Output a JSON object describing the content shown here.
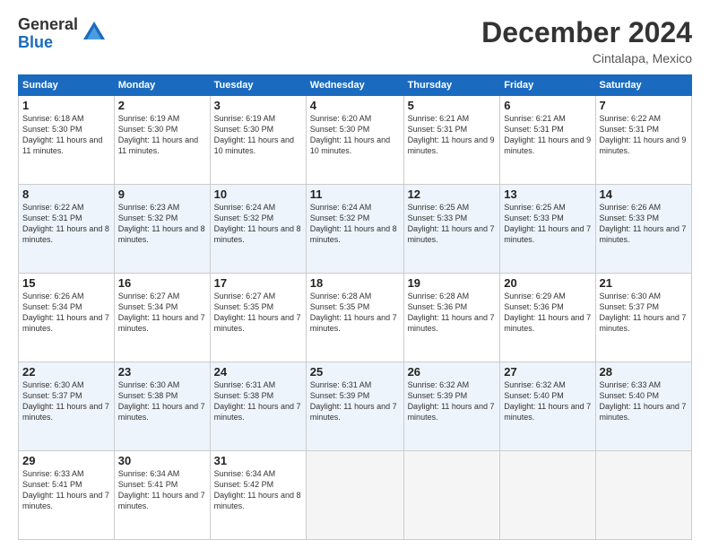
{
  "logo": {
    "general": "General",
    "blue": "Blue"
  },
  "title": "December 2024",
  "location": "Cintalapa, Mexico",
  "days_header": [
    "Sunday",
    "Monday",
    "Tuesday",
    "Wednesday",
    "Thursday",
    "Friday",
    "Saturday"
  ],
  "weeks": [
    [
      {
        "day": "1",
        "sunrise": "6:18 AM",
        "sunset": "5:30 PM",
        "daylight": "11 hours and 11 minutes."
      },
      {
        "day": "2",
        "sunrise": "6:19 AM",
        "sunset": "5:30 PM",
        "daylight": "11 hours and 11 minutes."
      },
      {
        "day": "3",
        "sunrise": "6:19 AM",
        "sunset": "5:30 PM",
        "daylight": "11 hours and 10 minutes."
      },
      {
        "day": "4",
        "sunrise": "6:20 AM",
        "sunset": "5:30 PM",
        "daylight": "11 hours and 10 minutes."
      },
      {
        "day": "5",
        "sunrise": "6:21 AM",
        "sunset": "5:31 PM",
        "daylight": "11 hours and 9 minutes."
      },
      {
        "day": "6",
        "sunrise": "6:21 AM",
        "sunset": "5:31 PM",
        "daylight": "11 hours and 9 minutes."
      },
      {
        "day": "7",
        "sunrise": "6:22 AM",
        "sunset": "5:31 PM",
        "daylight": "11 hours and 9 minutes."
      }
    ],
    [
      {
        "day": "8",
        "sunrise": "6:22 AM",
        "sunset": "5:31 PM",
        "daylight": "11 hours and 8 minutes."
      },
      {
        "day": "9",
        "sunrise": "6:23 AM",
        "sunset": "5:32 PM",
        "daylight": "11 hours and 8 minutes."
      },
      {
        "day": "10",
        "sunrise": "6:24 AM",
        "sunset": "5:32 PM",
        "daylight": "11 hours and 8 minutes."
      },
      {
        "day": "11",
        "sunrise": "6:24 AM",
        "sunset": "5:32 PM",
        "daylight": "11 hours and 8 minutes."
      },
      {
        "day": "12",
        "sunrise": "6:25 AM",
        "sunset": "5:33 PM",
        "daylight": "11 hours and 7 minutes."
      },
      {
        "day": "13",
        "sunrise": "6:25 AM",
        "sunset": "5:33 PM",
        "daylight": "11 hours and 7 minutes."
      },
      {
        "day": "14",
        "sunrise": "6:26 AM",
        "sunset": "5:33 PM",
        "daylight": "11 hours and 7 minutes."
      }
    ],
    [
      {
        "day": "15",
        "sunrise": "6:26 AM",
        "sunset": "5:34 PM",
        "daylight": "11 hours and 7 minutes."
      },
      {
        "day": "16",
        "sunrise": "6:27 AM",
        "sunset": "5:34 PM",
        "daylight": "11 hours and 7 minutes."
      },
      {
        "day": "17",
        "sunrise": "6:27 AM",
        "sunset": "5:35 PM",
        "daylight": "11 hours and 7 minutes."
      },
      {
        "day": "18",
        "sunrise": "6:28 AM",
        "sunset": "5:35 PM",
        "daylight": "11 hours and 7 minutes."
      },
      {
        "day": "19",
        "sunrise": "6:28 AM",
        "sunset": "5:36 PM",
        "daylight": "11 hours and 7 minutes."
      },
      {
        "day": "20",
        "sunrise": "6:29 AM",
        "sunset": "5:36 PM",
        "daylight": "11 hours and 7 minutes."
      },
      {
        "day": "21",
        "sunrise": "6:30 AM",
        "sunset": "5:37 PM",
        "daylight": "11 hours and 7 minutes."
      }
    ],
    [
      {
        "day": "22",
        "sunrise": "6:30 AM",
        "sunset": "5:37 PM",
        "daylight": "11 hours and 7 minutes."
      },
      {
        "day": "23",
        "sunrise": "6:30 AM",
        "sunset": "5:38 PM",
        "daylight": "11 hours and 7 minutes."
      },
      {
        "day": "24",
        "sunrise": "6:31 AM",
        "sunset": "5:38 PM",
        "daylight": "11 hours and 7 minutes."
      },
      {
        "day": "25",
        "sunrise": "6:31 AM",
        "sunset": "5:39 PM",
        "daylight": "11 hours and 7 minutes."
      },
      {
        "day": "26",
        "sunrise": "6:32 AM",
        "sunset": "5:39 PM",
        "daylight": "11 hours and 7 minutes."
      },
      {
        "day": "27",
        "sunrise": "6:32 AM",
        "sunset": "5:40 PM",
        "daylight": "11 hours and 7 minutes."
      },
      {
        "day": "28",
        "sunrise": "6:33 AM",
        "sunset": "5:40 PM",
        "daylight": "11 hours and 7 minutes."
      }
    ],
    [
      {
        "day": "29",
        "sunrise": "6:33 AM",
        "sunset": "5:41 PM",
        "daylight": "11 hours and 7 minutes."
      },
      {
        "day": "30",
        "sunrise": "6:34 AM",
        "sunset": "5:41 PM",
        "daylight": "11 hours and 7 minutes."
      },
      {
        "day": "31",
        "sunrise": "6:34 AM",
        "sunset": "5:42 PM",
        "daylight": "11 hours and 8 minutes."
      },
      null,
      null,
      null,
      null
    ]
  ],
  "labels": {
    "sunrise": "Sunrise:",
    "sunset": "Sunset:",
    "daylight": "Daylight:"
  }
}
